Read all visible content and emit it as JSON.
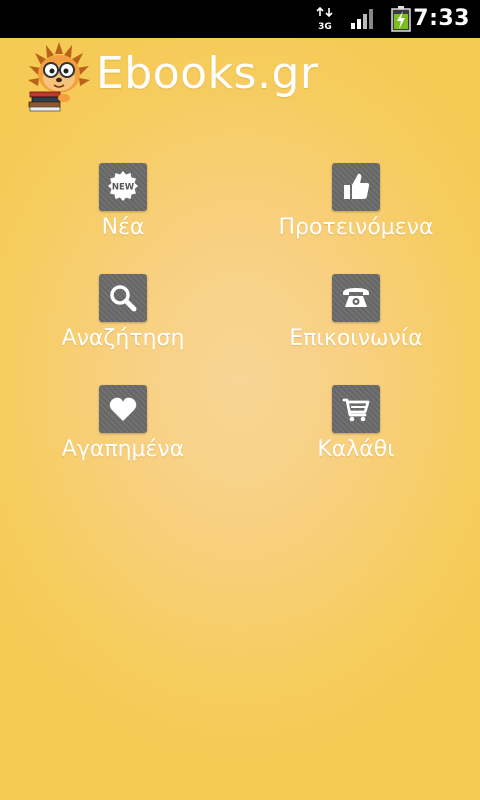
{
  "status_bar": {
    "network_type": "3G",
    "time": "7:33",
    "icons": [
      "network-3g-icon",
      "signal-strength-icon",
      "battery-charging-icon"
    ]
  },
  "header": {
    "title": "Ebooks.gr",
    "logo": "hedgehog-with-books-logo"
  },
  "menu": {
    "items": [
      {
        "label": "Νέα",
        "icon": "new-badge-icon",
        "badge_text": "NEW"
      },
      {
        "label": "Προτεινόμενα",
        "icon": "thumbs-up-icon"
      },
      {
        "label": "Αναζήτηση",
        "icon": "search-icon"
      },
      {
        "label": "Επικοινωνία",
        "icon": "telephone-icon"
      },
      {
        "label": "Αγαπημένα",
        "icon": "heart-icon"
      },
      {
        "label": "Καλάθι",
        "icon": "shopping-cart-icon"
      }
    ]
  },
  "colors": {
    "background": "#f6cc5e",
    "background_center": "#f8d596",
    "tile": "#666666",
    "text": "#ffffff",
    "status_bar": "#000000"
  }
}
